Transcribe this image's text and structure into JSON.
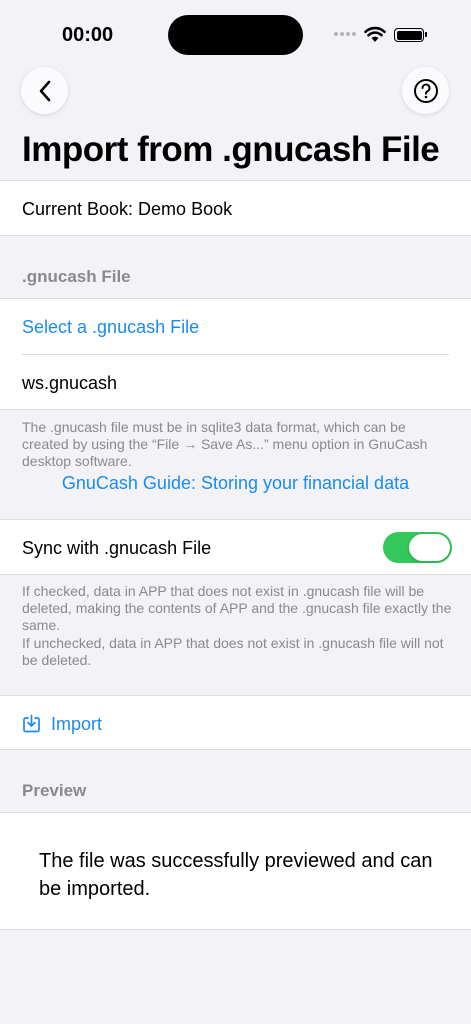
{
  "status_bar": {
    "time": "00:00"
  },
  "page": {
    "title": "Import from .gnucash File"
  },
  "current_book": {
    "label": "Current Book: Demo Book"
  },
  "file_section": {
    "header": ".gnucash File",
    "select_label": "Select a .gnucash File",
    "selected_file": "ws.gnucash",
    "note": "The .gnucash file must be in sqlite3 data format, which can be created by using the “File → Save As...” menu option in GnuCash desktop software.",
    "guide_link": "GnuCash Guide: Storing your financial data"
  },
  "sync": {
    "label": "Sync with .gnucash File",
    "enabled": true,
    "note_checked": "If checked, data in APP that does not exist in .gnucash file will be deleted, making the contents of APP and the .gnucash file exactly the same.",
    "note_unchecked": "If unchecked, data in APP that does not exist in .gnucash file will not be deleted."
  },
  "import": {
    "label": "Import"
  },
  "preview": {
    "header": "Preview",
    "message": "The file was successfully previewed and can be imported."
  },
  "colors": {
    "accent": "#1a8cf0",
    "toggle_on": "#34c759",
    "background": "#f2f2f7",
    "secondary_text": "#8a8a8e"
  }
}
